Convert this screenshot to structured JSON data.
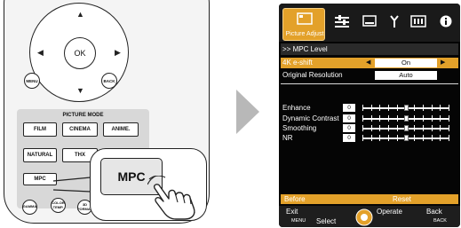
{
  "remote": {
    "ok_label": "OK",
    "menu_label": "MENU",
    "back_label": "BACK",
    "picture_mode_title": "PICTURE MODE",
    "mode_buttons": [
      "FILM",
      "CINEMA",
      "ANIME.",
      "NATURAL",
      "THX"
    ],
    "mpc_label": "MPC",
    "gamma_label": "GAMMA",
    "color_temp_label": "COLOR TEMP.",
    "three_d_format_label": "3D FORMAT",
    "zoom_mpc_label": "MPC"
  },
  "osd": {
    "active_tab_label": "Picture Adjust",
    "tab_icons": [
      "picture-adjust-icon",
      "settings-sliders-icon",
      "display-icon",
      "installation-icon",
      "input-signal-icon",
      "info-icon"
    ],
    "breadcrumb": ">> MPC Level",
    "rows": [
      {
        "label": "4K e-shift",
        "value": "On"
      },
      {
        "label": "Original Resolution",
        "value": "Auto"
      }
    ],
    "sliders": [
      {
        "label": "Enhance",
        "value": "0",
        "level": 0.5
      },
      {
        "label": "Dynamic Contrast",
        "value": "0",
        "level": 0.5
      },
      {
        "label": "Smoothing",
        "value": "0",
        "level": 0.5
      },
      {
        "label": "NR",
        "value": "0",
        "level": 0.5
      }
    ],
    "before_label": "Before",
    "reset_label": "Reset",
    "nav": {
      "exit": "Exit",
      "menu": "MENU",
      "select": "Select",
      "operate": "Operate",
      "back": "Back",
      "back_small": "BACK"
    },
    "accent_color": "#e3a12a"
  }
}
